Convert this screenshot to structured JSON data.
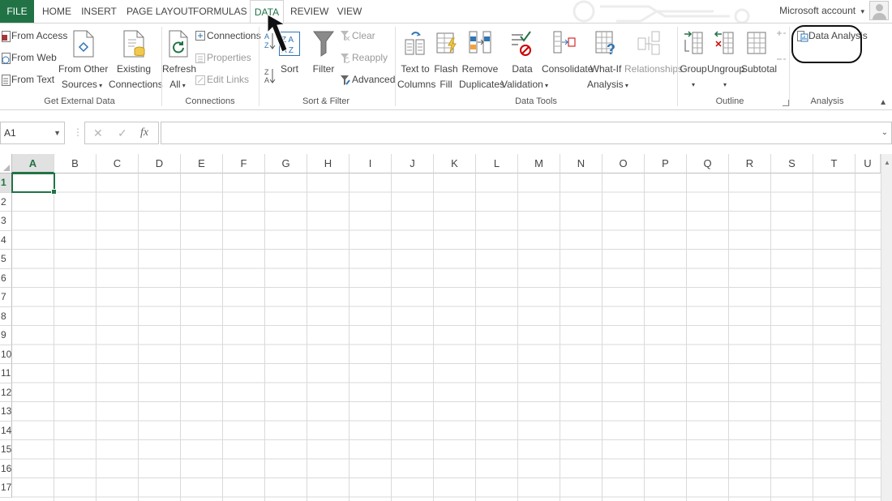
{
  "tabs": {
    "file": "FILE",
    "home": "HOME",
    "insert": "INSERT",
    "page_layout": "PAGE LAYOUT",
    "formulas": "FORMULAS",
    "data": "DATA",
    "review": "REVIEW",
    "view": "VIEW",
    "active": "DATA"
  },
  "account": {
    "label": "Microsoft account",
    "dropdown": "▾"
  },
  "ribbon": {
    "get_external_data": {
      "from_access": "From Access",
      "from_web": "From Web",
      "from_text": "From Text",
      "from_other_1": "From Other",
      "from_other_2": "Sources",
      "existing_1": "Existing",
      "existing_2": "Connections",
      "group_label": "Get External Data"
    },
    "connections": {
      "refresh_1": "Refresh",
      "refresh_2": "All",
      "connections": "Connections",
      "properties": "Properties",
      "edit_links": "Edit Links",
      "group_label": "Connections"
    },
    "sort_filter": {
      "sort": "Sort",
      "filter": "Filter",
      "clear": "Clear",
      "reapply": "Reapply",
      "advanced": "Advanced",
      "group_label": "Sort & Filter"
    },
    "data_tools": {
      "text_to_columns_1": "Text to",
      "text_to_columns_2": "Columns",
      "flash_fill_1": "Flash",
      "flash_fill_2": "Fill",
      "remove_dup_1": "Remove",
      "remove_dup_2": "Duplicates",
      "validation_1": "Data",
      "validation_2": "Validation",
      "consolidate": "Consolidate",
      "whatif_1": "What-If",
      "whatif_2": "Analysis",
      "relationships": "Relationships",
      "group_label": "Data Tools"
    },
    "outline": {
      "group": "Group",
      "ungroup": "Ungroup",
      "subtotal": "Subtotal",
      "group_label": "Outline"
    },
    "analysis": {
      "data_analysis": "Data Analysis",
      "group_label": "Analysis"
    }
  },
  "formula_bar": {
    "name_box": "A1",
    "cancel": "✕",
    "enter": "✓",
    "fx": "fx",
    "value": ""
  },
  "grid": {
    "columns": [
      "A",
      "B",
      "C",
      "D",
      "E",
      "F",
      "G",
      "H",
      "I",
      "J",
      "K",
      "L",
      "M",
      "N",
      "O",
      "P",
      "Q",
      "R",
      "S",
      "T",
      "U"
    ],
    "rows": [
      "1",
      "2",
      "3",
      "4",
      "5",
      "6",
      "7",
      "8",
      "9",
      "10",
      "11",
      "12",
      "13",
      "14",
      "15",
      "16",
      "17"
    ],
    "active_cell": "A1"
  },
  "colors": {
    "accent": "#217346",
    "highlight_ring": "#111111"
  }
}
